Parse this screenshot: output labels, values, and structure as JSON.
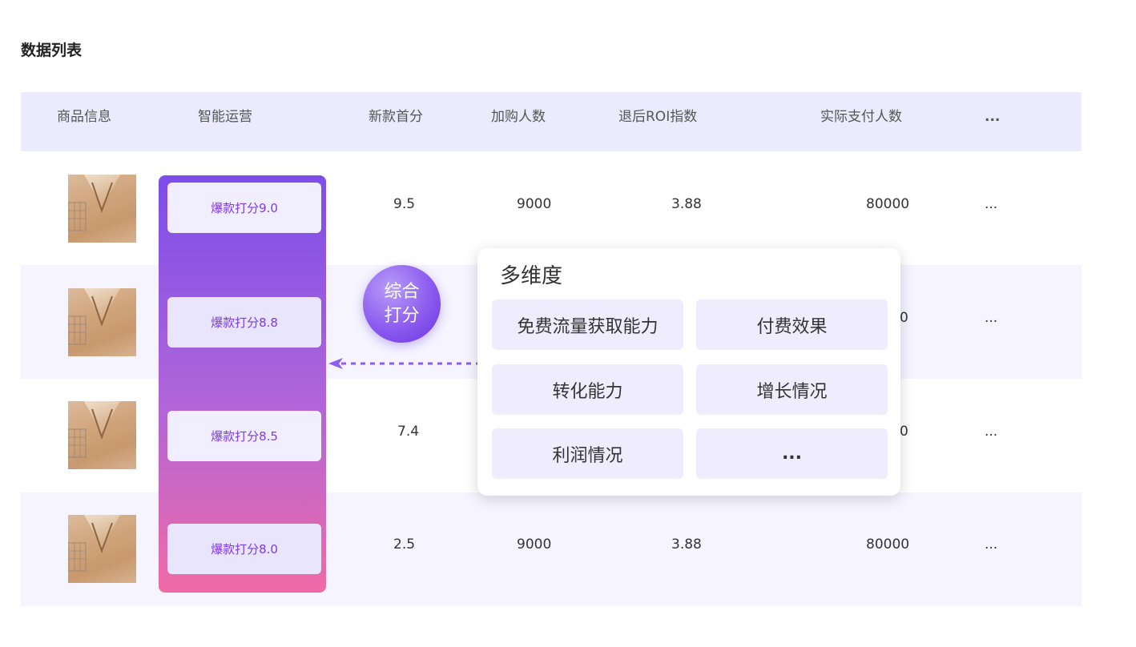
{
  "page": {
    "title": "数据列表"
  },
  "table": {
    "columns": [
      "商品信息",
      "智能运营",
      "新款首分",
      "加购人数",
      "退后ROI指数",
      "实际支付人数",
      "..."
    ],
    "rows": [
      {
        "score_label": "爆款打分9.0",
        "new_score": "9.5",
        "cart_count": "9000",
        "roi_index": "3.88",
        "paid_count": "80000",
        "more": "..."
      },
      {
        "score_label": "爆款打分8.8",
        "new_score": "",
        "cart_count": "",
        "roi_index": "",
        "paid_count": "0",
        "more": "..."
      },
      {
        "score_label": "爆款打分8.5",
        "new_score": "7.4",
        "cart_count": "",
        "roi_index": "",
        "paid_count": "0",
        "more": "..."
      },
      {
        "score_label": "爆款打分8.0",
        "new_score": "2.5",
        "cart_count": "9000",
        "roi_index": "3.88",
        "paid_count": "80000",
        "more": "..."
      }
    ]
  },
  "badge": {
    "line1": "综合",
    "line2": "打分"
  },
  "popup": {
    "title": "多维度",
    "items": [
      "免费流量获取能力",
      "付费效果",
      "转化能力",
      "增长情况",
      "利润情况",
      "..."
    ]
  },
  "colors": {
    "accent": "#7C3AED",
    "header_bg": "#ECEBFD",
    "row_alt_bg": "#F5F4FF",
    "frame_top": "#7C4DEA",
    "frame_bottom": "#F06BA6"
  },
  "icons": {
    "thumbnail": "product-thumbnail",
    "arrow": "dashed-arrow-left-icon"
  }
}
